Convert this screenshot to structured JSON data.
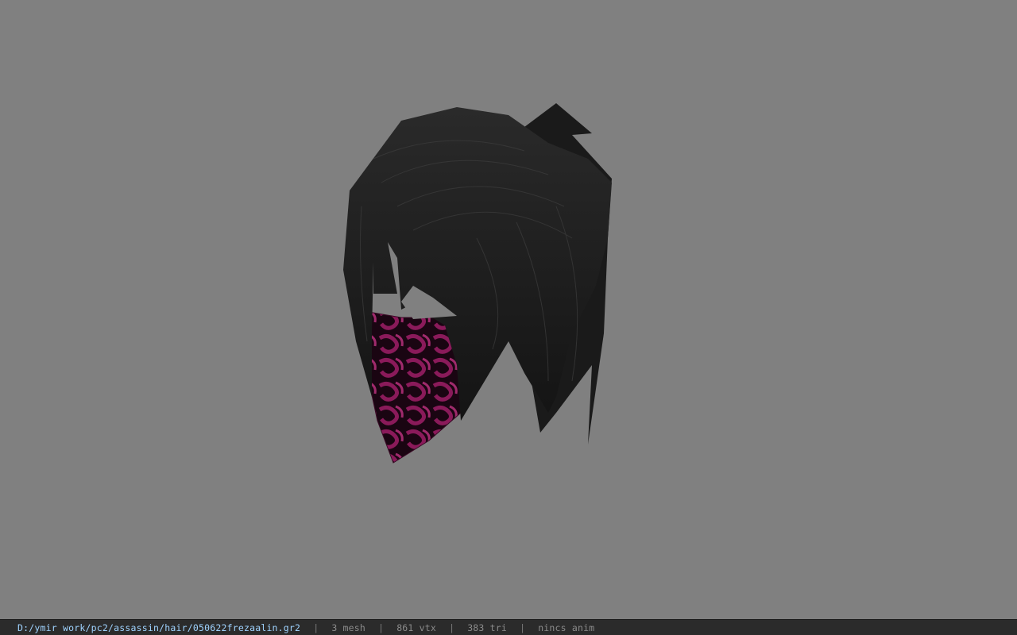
{
  "viewport": {
    "background_color": "#808080",
    "model_icon": "hair-mesh-icon",
    "hair_color": "#1e1e1e",
    "mask_color": "#7a1450"
  },
  "statusbar": {
    "path": "D:/ymir work/pc2/assassin/hair/050622frezaalin.gr2",
    "separator": "|",
    "mesh": "3 mesh",
    "vtx": "861 vtx",
    "tri": "383 tri",
    "anim": "nincs anim"
  }
}
